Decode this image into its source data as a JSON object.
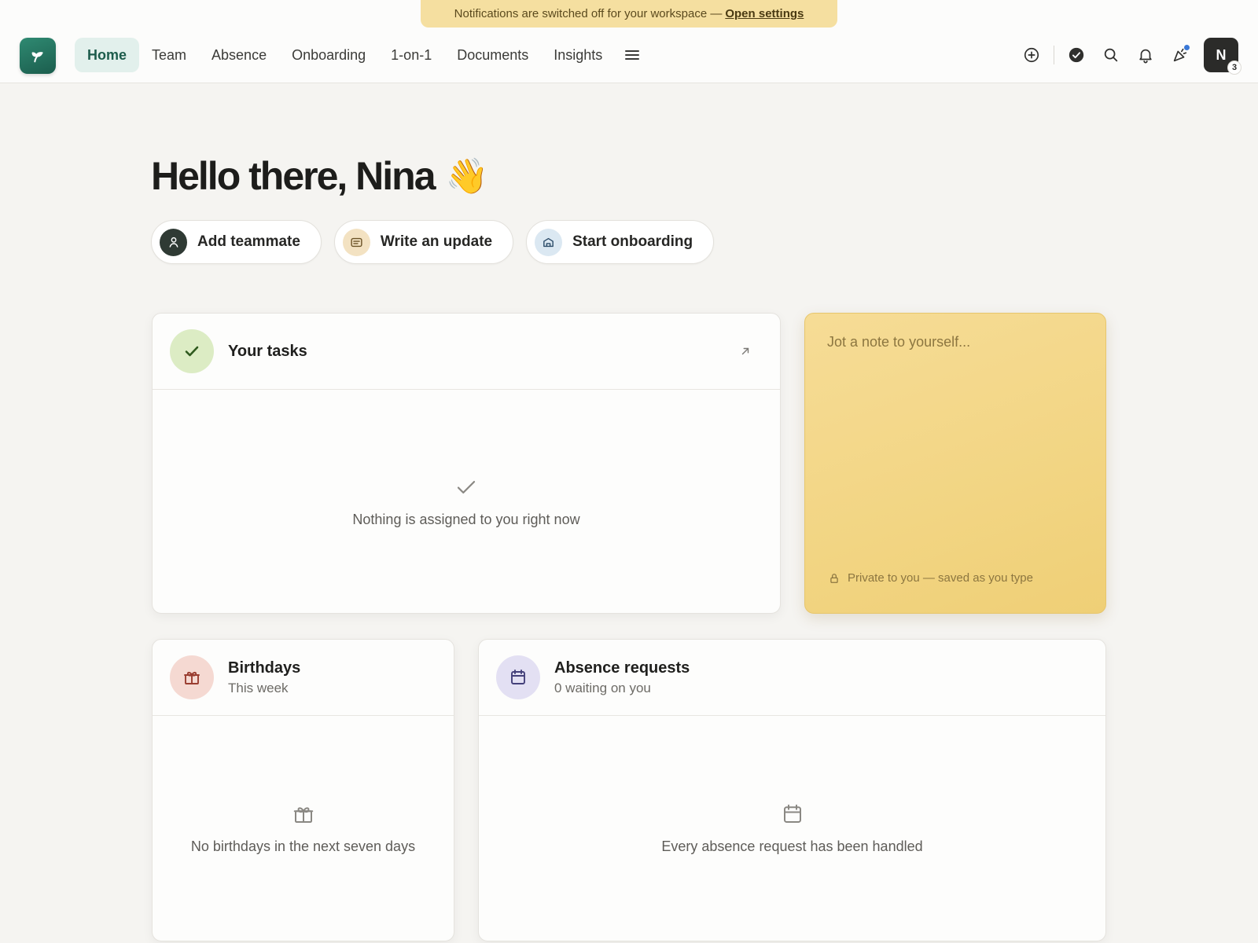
{
  "banner": {
    "text": "Notifications are switched off for your workspace —",
    "link": "Open settings"
  },
  "nav": {
    "items": [
      {
        "label": "Home",
        "active": true
      },
      {
        "label": "Team"
      },
      {
        "label": "Absence"
      },
      {
        "label": "Onboarding"
      },
      {
        "label": "1-on-1"
      },
      {
        "label": "Documents"
      },
      {
        "label": "Insights"
      }
    ],
    "menu_icon": "hamburger-menu-icon"
  },
  "header_actions": {
    "icons": [
      "plus-circle-icon",
      "check-circle-icon",
      "search-icon",
      "bell-icon",
      "party-popper-icon"
    ],
    "avatar_initial": "N",
    "avatar_badge": "3"
  },
  "greeting": {
    "text": "Hello there, Nina",
    "emoji": "👋"
  },
  "quick_actions": [
    {
      "label": "Add teammate",
      "icon": "person-icon",
      "color": "#2f3a34"
    },
    {
      "label": "Write an update",
      "icon": "message-icon",
      "color": "#f3e2c2"
    },
    {
      "label": "Start onboarding",
      "icon": "home-door-icon",
      "color": "#dbe8f2"
    }
  ],
  "tasks": {
    "title": "Your tasks",
    "empty": "Nothing is assigned to you right now",
    "icon_color": "#dcecc4"
  },
  "note": {
    "placeholder": "Jot a note to yourself...",
    "footer": "Private to you — saved as you type"
  },
  "birthdays": {
    "title": "Birthdays",
    "subtitle": "This week",
    "empty": "No birthdays in the next seven days",
    "icon_color": "#f5d9d2"
  },
  "absence": {
    "title": "Absence requests",
    "subtitle": "0 waiting on you",
    "empty": "Every absence request has been handled",
    "icon_color": "#e3e0f3"
  },
  "colors": {
    "brand": "#1f6b57",
    "background": "#f5f4f1",
    "note": "#f2d583",
    "banner": "#f5dfa0"
  }
}
